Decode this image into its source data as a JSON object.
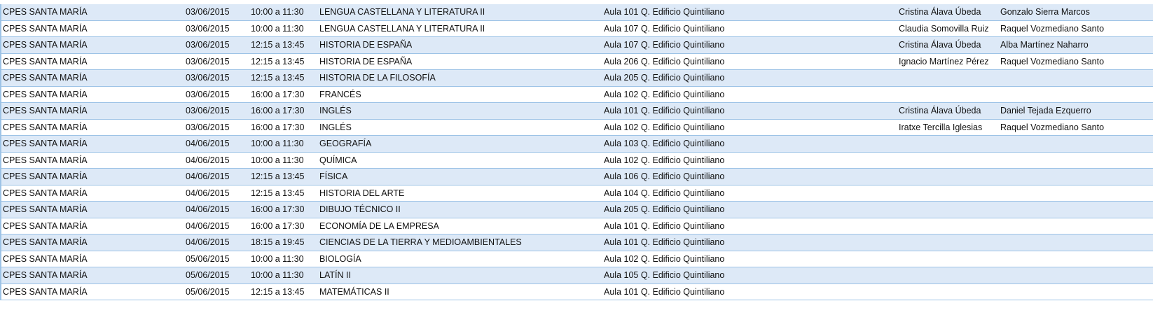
{
  "rows": [
    {
      "center": "CPES SANTA MARÍA",
      "date": "03/06/2015",
      "time": "10:00 a 11:30",
      "subject": "LENGUA CASTELLANA Y LITERATURA II",
      "room": "Aula 101 Q. Edificio Quintiliano",
      "vig1": "Cristina Álava Úbeda",
      "vig2": "Gonzalo Sierra Marcos"
    },
    {
      "center": "CPES SANTA MARÍA",
      "date": "03/06/2015",
      "time": "10:00 a 11:30",
      "subject": "LENGUA CASTELLANA Y LITERATURA II",
      "room": "Aula 107 Q. Edificio Quintiliano",
      "vig1": "Claudia Somovilla Ruiz",
      "vig2": "Raquel Vozmediano Santo"
    },
    {
      "center": "CPES SANTA MARÍA",
      "date": "03/06/2015",
      "time": "12:15 a 13:45",
      "subject": "HISTORIA DE ESPAÑA",
      "room": "Aula 107 Q. Edificio Quintiliano",
      "vig1": "Cristina Álava Úbeda",
      "vig2": "Alba Martínez Naharro"
    },
    {
      "center": "CPES SANTA MARÍA",
      "date": "03/06/2015",
      "time": "12:15 a 13:45",
      "subject": "HISTORIA DE ESPAÑA",
      "room": "Aula 206 Q. Edificio Quintiliano",
      "vig1": "Ignacio Martínez Pérez",
      "vig2": "Raquel Vozmediano Santo"
    },
    {
      "center": "CPES SANTA MARÍA",
      "date": "03/06/2015",
      "time": "12:15 a 13:45",
      "subject": "HISTORIA DE LA FILOSOFÍA",
      "room": "Aula 205 Q. Edificio Quintiliano",
      "vig1": "",
      "vig2": ""
    },
    {
      "center": "CPES SANTA MARÍA",
      "date": "03/06/2015",
      "time": "16:00 a 17:30",
      "subject": "FRANCÉS",
      "room": "Aula 102 Q. Edificio Quintiliano",
      "vig1": "",
      "vig2": ""
    },
    {
      "center": "CPES SANTA MARÍA",
      "date": "03/06/2015",
      "time": "16:00 a 17:30",
      "subject": "INGLÉS",
      "room": "Aula 101 Q. Edificio Quintiliano",
      "vig1": "Cristina Álava Úbeda",
      "vig2": "Daniel Tejada Ezquerro"
    },
    {
      "center": "CPES SANTA MARÍA",
      "date": "03/06/2015",
      "time": "16:00 a 17:30",
      "subject": "INGLÉS",
      "room": "Aula 102 Q. Edificio Quintiliano",
      "vig1": "Iratxe Tercilla Iglesias",
      "vig2": "Raquel Vozmediano Santo"
    },
    {
      "center": "CPES SANTA MARÍA",
      "date": "04/06/2015",
      "time": "10:00 a 11:30",
      "subject": "GEOGRAFÍA",
      "room": "Aula 103 Q. Edificio Quintiliano",
      "vig1": "",
      "vig2": ""
    },
    {
      "center": "CPES SANTA MARÍA",
      "date": "04/06/2015",
      "time": "10:00 a 11:30",
      "subject": "QUÍMICA",
      "room": "Aula 102 Q. Edificio Quintiliano",
      "vig1": "",
      "vig2": ""
    },
    {
      "center": "CPES SANTA MARÍA",
      "date": "04/06/2015",
      "time": "12:15 a 13:45",
      "subject": "FÍSICA",
      "room": "Aula 106 Q. Edificio Quintiliano",
      "vig1": "",
      "vig2": ""
    },
    {
      "center": "CPES SANTA MARÍA",
      "date": "04/06/2015",
      "time": "12:15 a 13:45",
      "subject": "HISTORIA DEL ARTE",
      "room": "Aula 104 Q. Edificio Quintiliano",
      "vig1": "",
      "vig2": ""
    },
    {
      "center": "CPES SANTA MARÍA",
      "date": "04/06/2015",
      "time": "16:00 a 17:30",
      "subject": "DIBUJO TÉCNICO II",
      "room": "Aula 205 Q. Edificio Quintiliano",
      "vig1": "",
      "vig2": ""
    },
    {
      "center": "CPES SANTA MARÍA",
      "date": "04/06/2015",
      "time": "16:00 a 17:30",
      "subject": "ECONOMÍA DE LA EMPRESA",
      "room": "Aula 101 Q. Edificio Quintiliano",
      "vig1": "",
      "vig2": ""
    },
    {
      "center": "CPES SANTA MARÍA",
      "date": "04/06/2015",
      "time": "18:15 a 19:45",
      "subject": "CIENCIAS DE LA TIERRA Y MEDIOAMBIENTALES",
      "room": "Aula 101 Q. Edificio Quintiliano",
      "vig1": "",
      "vig2": ""
    },
    {
      "center": "CPES SANTA MARÍA",
      "date": "05/06/2015",
      "time": "10:00 a 11:30",
      "subject": "BIOLOGÍA",
      "room": "Aula 102 Q. Edificio Quintiliano",
      "vig1": "",
      "vig2": ""
    },
    {
      "center": "CPES SANTA MARÍA",
      "date": "05/06/2015",
      "time": "10:00 a 11:30",
      "subject": "LATÍN II",
      "room": "Aula 105 Q. Edificio Quintiliano",
      "vig1": "",
      "vig2": ""
    },
    {
      "center": "CPES SANTA MARÍA",
      "date": "05/06/2015",
      "time": "12:15 a 13:45",
      "subject": "MATEMÁTICAS II",
      "room": "Aula 101 Q. Edificio Quintiliano",
      "vig1": "",
      "vig2": ""
    }
  ],
  "colors": {
    "band": "#dde9f7",
    "plain": "#ffffff",
    "gridline": "#9dc3e6"
  }
}
